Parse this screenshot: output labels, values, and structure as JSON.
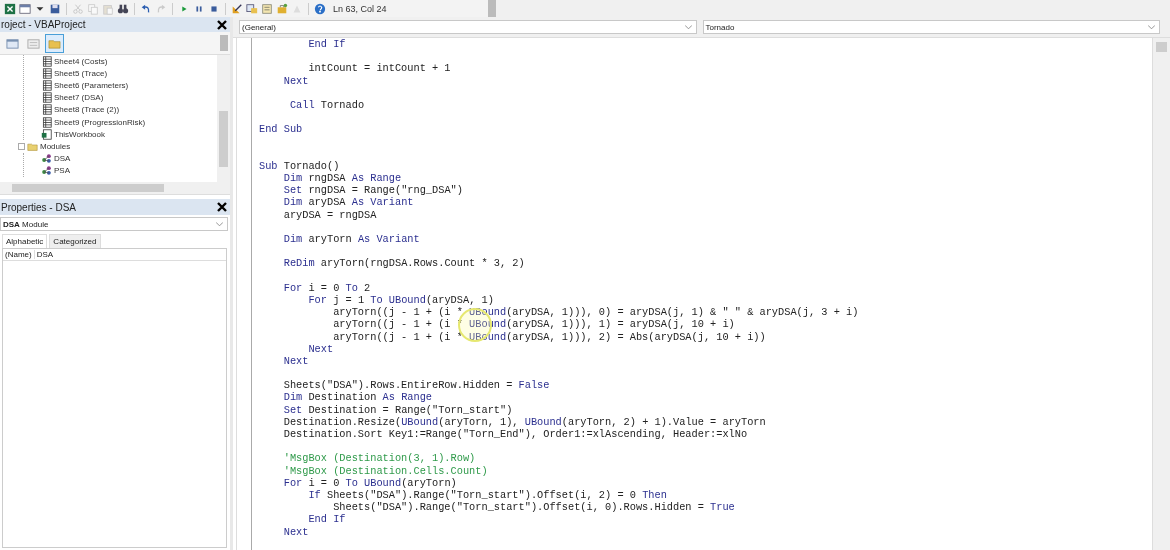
{
  "toolbar": {
    "buttons": [
      {
        "kind": "excel",
        "disabled": false
      },
      {
        "kind": "form",
        "disabled": false
      },
      {
        "kind": "dropdown",
        "disabled": false
      },
      {
        "kind": "save",
        "disabled": false
      },
      {
        "kind": "cut",
        "disabled": true
      },
      {
        "kind": "copy",
        "disabled": true
      },
      {
        "kind": "paste",
        "disabled": true
      },
      {
        "kind": "find",
        "disabled": false
      },
      {
        "kind": "undo",
        "disabled": false
      },
      {
        "kind": "redo",
        "disabled": true
      },
      {
        "kind": "run",
        "disabled": false
      },
      {
        "kind": "pause",
        "disabled": false
      },
      {
        "kind": "stop",
        "disabled": false
      },
      {
        "kind": "design",
        "disabled": false
      },
      {
        "kind": "explorer",
        "disabled": false
      },
      {
        "kind": "properties",
        "disabled": false
      },
      {
        "kind": "toolbox",
        "disabled": false
      },
      {
        "kind": "browser",
        "disabled": true
      },
      {
        "kind": "help",
        "disabled": false
      }
    ],
    "position": "Ln 63, Col 24"
  },
  "project_explorer": {
    "title": "roject - VBAProject",
    "tools": [
      {
        "kind": "view-code",
        "selected": false
      },
      {
        "kind": "view-object",
        "selected": false
      },
      {
        "kind": "toggle-folders",
        "selected": true
      }
    ],
    "tree": [
      {
        "kind": "group",
        "children": [
          {
            "kind": "sheet",
            "label": "Sheet4 (Costs)"
          },
          {
            "kind": "sheet",
            "label": "Sheet5 (Trace)"
          },
          {
            "kind": "sheet",
            "label": "Sheet6 (Parameters)"
          },
          {
            "kind": "sheet",
            "label": "Sheet7 (DSA)"
          },
          {
            "kind": "sheet",
            "label": "Sheet8 (Trace (2))"
          },
          {
            "kind": "sheet",
            "label": "Sheet9 (ProgressionRisk)"
          },
          {
            "kind": "workbook",
            "label": "ThisWorkbook"
          }
        ]
      },
      {
        "kind": "folder",
        "label": "Modules",
        "expanded": true,
        "children": [
          {
            "kind": "module",
            "label": "DSA"
          },
          {
            "kind": "module",
            "label": "PSA"
          }
        ]
      }
    ]
  },
  "properties": {
    "title": "Properties - DSA",
    "object": "**DSA** Module",
    "tabs": [
      {
        "label": "Alphabetic",
        "selected": true
      },
      {
        "label": "Categorized",
        "selected": false
      }
    ],
    "rows": [
      {
        "name": "(Name)",
        "value": "DSA"
      }
    ]
  },
  "code_window": {
    "object": "(General)",
    "procedure": "Tornado",
    "lines": [
      {
        "kind": "code",
        "segments": [
          {
            "text": "        End If",
            "kind": "keyword"
          }
        ]
      },
      {
        "kind": "blank"
      },
      {
        "kind": "code",
        "segments": [
          {
            "text": "        intCount = intCount + 1",
            "kind": "plain"
          }
        ]
      },
      {
        "kind": "code",
        "segments": [
          {
            "text": "    Next",
            "kind": "keyword"
          }
        ]
      },
      {
        "kind": "blank"
      },
      {
        "kind": "code",
        "segments": [
          {
            "text": "     Call",
            "kind": "keyword"
          },
          {
            "text": " Tornado",
            "kind": "plain"
          }
        ]
      },
      {
        "kind": "blank"
      },
      {
        "kind": "code",
        "segments": [
          {
            "text": "End Sub",
            "kind": "keyword"
          }
        ]
      },
      {
        "kind": "blank"
      },
      {
        "kind": "blank"
      },
      {
        "kind": "code",
        "segments": [
          {
            "text": "Sub",
            "kind": "keyword"
          },
          {
            "text": " Tornado()",
            "kind": "plain"
          }
        ]
      },
      {
        "kind": "code",
        "segments": [
          {
            "text": "    Dim",
            "kind": "keyword"
          },
          {
            "text": " rngDSA ",
            "kind": "plain"
          },
          {
            "text": "As Range",
            "kind": "keyword"
          }
        ]
      },
      {
        "kind": "code",
        "segments": [
          {
            "text": "    Set",
            "kind": "keyword"
          },
          {
            "text": " rngDSA = Range(\"rng_DSA\")",
            "kind": "plain"
          }
        ]
      },
      {
        "kind": "code",
        "segments": [
          {
            "text": "    Dim",
            "kind": "keyword"
          },
          {
            "text": " aryDSA ",
            "kind": "plain"
          },
          {
            "text": "As Variant",
            "kind": "keyword"
          }
        ]
      },
      {
        "kind": "code",
        "segments": [
          {
            "text": "    aryDSA = rngDSA",
            "kind": "plain"
          }
        ]
      },
      {
        "kind": "blank"
      },
      {
        "kind": "code",
        "segments": [
          {
            "text": "    Dim",
            "kind": "keyword"
          },
          {
            "text": " aryTorn ",
            "kind": "plain"
          },
          {
            "text": "As Variant",
            "kind": "keyword"
          }
        ]
      },
      {
        "kind": "blank"
      },
      {
        "kind": "code",
        "segments": [
          {
            "text": "    ReDim",
            "kind": "keyword"
          },
          {
            "text": " aryTorn(rngDSA.Rows.Count * 3, 2)",
            "kind": "plain"
          }
        ]
      },
      {
        "kind": "blank"
      },
      {
        "kind": "code",
        "segments": [
          {
            "text": "    For",
            "kind": "keyword"
          },
          {
            "text": " i = 0 ",
            "kind": "plain"
          },
          {
            "text": "To",
            "kind": "keyword"
          },
          {
            "text": " 2",
            "kind": "plain"
          }
        ]
      },
      {
        "kind": "code",
        "segments": [
          {
            "text": "        For",
            "kind": "keyword"
          },
          {
            "text": " j = 1 ",
            "kind": "plain"
          },
          {
            "text": "To UBound",
            "kind": "keyword"
          },
          {
            "text": "(aryDSA, 1)",
            "kind": "plain"
          }
        ]
      },
      {
        "kind": "code",
        "segments": [
          {
            "text": "            aryTorn((j - 1 + (i * ",
            "kind": "plain"
          },
          {
            "text": "UBound",
            "kind": "keyword"
          },
          {
            "text": "(aryDSA, 1))), 0) = aryDSA(j, 1) & \" \" & aryDSA(j, 3 + i)",
            "kind": "plain"
          }
        ]
      },
      {
        "kind": "code",
        "segments": [
          {
            "text": "            aryTorn((j - 1 + (i * ",
            "kind": "plain"
          },
          {
            "text": "UBound",
            "kind": "keyword"
          },
          {
            "text": "(aryDSA, 1))), 1) = aryDSA(j, 10 + i)",
            "kind": "plain"
          }
        ]
      },
      {
        "kind": "code",
        "segments": [
          {
            "text": "            aryTorn((j - 1 + (i * ",
            "kind": "plain"
          },
          {
            "text": "UBound",
            "kind": "keyword"
          },
          {
            "text": "(aryDSA, 1))), 2) = Abs(aryDSA(j, 10 + i))",
            "kind": "plain"
          }
        ]
      },
      {
        "kind": "code",
        "segments": [
          {
            "text": "        Next",
            "kind": "keyword"
          }
        ]
      },
      {
        "kind": "code",
        "segments": [
          {
            "text": "    Next",
            "kind": "keyword"
          }
        ]
      },
      {
        "kind": "blank"
      },
      {
        "kind": "code",
        "segments": [
          {
            "text": "    Sheets(\"DSA\").Rows.EntireRow.Hidden = ",
            "kind": "plain"
          },
          {
            "text": "False",
            "kind": "keyword"
          }
        ]
      },
      {
        "kind": "code",
        "segments": [
          {
            "text": "    Dim",
            "kind": "keyword"
          },
          {
            "text": " Destination ",
            "kind": "plain"
          },
          {
            "text": "As Range",
            "kind": "keyword"
          }
        ]
      },
      {
        "kind": "code",
        "segments": [
          {
            "text": "    Set",
            "kind": "keyword"
          },
          {
            "text": " Destination = Range(\"Torn_start\")",
            "kind": "plain"
          }
        ]
      },
      {
        "kind": "code",
        "segments": [
          {
            "text": "    Destination.Resize(",
            "kind": "plain"
          },
          {
            "text": "UBound",
            "kind": "keyword"
          },
          {
            "text": "(aryTorn, 1), ",
            "kind": "plain"
          },
          {
            "text": "UBound",
            "kind": "keyword"
          },
          {
            "text": "(aryTorn, 2) + 1).Value = aryTorn",
            "kind": "plain"
          }
        ]
      },
      {
        "kind": "code",
        "segments": [
          {
            "text": "    Destination.Sort Key1:=Range(\"Torn_End\"), Order1:=xlAscending, Header:=xlNo",
            "kind": "plain"
          }
        ]
      },
      {
        "kind": "blank"
      },
      {
        "kind": "code",
        "segments": [
          {
            "text": "    'MsgBox (Destination(3, 1).Row)",
            "kind": "comment"
          }
        ]
      },
      {
        "kind": "code",
        "segments": [
          {
            "text": "    'MsgBox (Destination.Cells.Count)",
            "kind": "comment"
          }
        ]
      },
      {
        "kind": "code",
        "segments": [
          {
            "text": "    For",
            "kind": "keyword"
          },
          {
            "text": " i = 0 ",
            "kind": "plain"
          },
          {
            "text": "To UBound",
            "kind": "keyword"
          },
          {
            "text": "(aryTorn)",
            "kind": "plain"
          }
        ]
      },
      {
        "kind": "code",
        "segments": [
          {
            "text": "        If",
            "kind": "keyword"
          },
          {
            "text": " Sheets(\"DSA\").Range(\"Torn_start\").Offset(i, 2) = 0 ",
            "kind": "plain"
          },
          {
            "text": "Then",
            "kind": "keyword"
          }
        ]
      },
      {
        "kind": "code",
        "segments": [
          {
            "text": "            Sheets(\"DSA\").Range(\"Torn_start\").Offset(i, 0).Rows.Hidden = ",
            "kind": "plain"
          },
          {
            "text": "True",
            "kind": "keyword"
          }
        ]
      },
      {
        "kind": "code",
        "segments": [
          {
            "text": "        End If",
            "kind": "keyword"
          }
        ]
      },
      {
        "kind": "code",
        "segments": [
          {
            "text": "    Next",
            "kind": "keyword"
          }
        ]
      }
    ]
  }
}
